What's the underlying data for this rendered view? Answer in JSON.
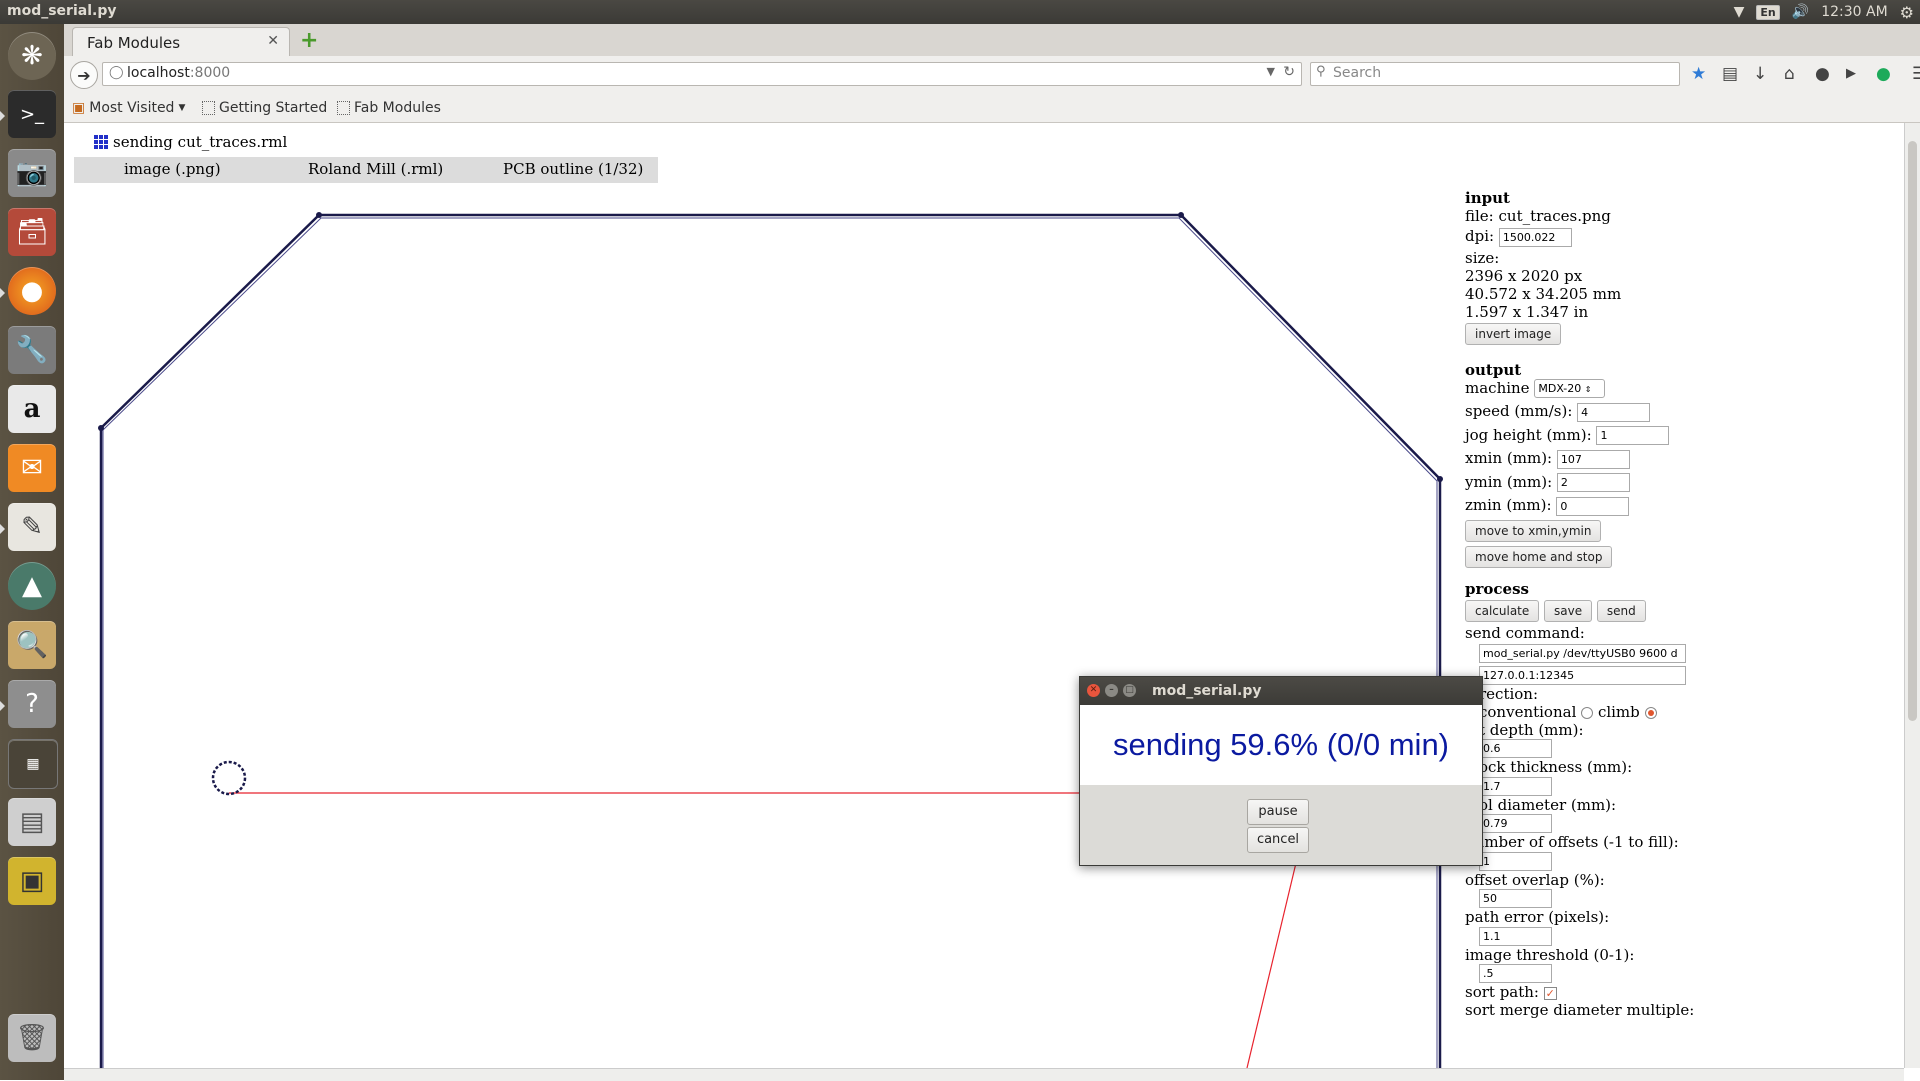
{
  "window": {
    "app_title": "mod_serial.py",
    "clock": "12:30 AM",
    "keyboard_layout": "En"
  },
  "launcher": {
    "items": [
      "dash-icon",
      "terminal-icon",
      "camera-icon",
      "files-icon",
      "firefox-icon",
      "settings-icon",
      "amazon-icon",
      "mail-icon",
      "text-editor-icon",
      "software-updater-icon",
      "image-viewer-icon",
      "help-icon",
      "workspaces-icon",
      "drive-icon",
      "remote-desktop-icon",
      "trash-icon"
    ]
  },
  "browser": {
    "tab_title": "Fab Modules",
    "url_host": "localhost",
    "url_port": ":8000",
    "search_placeholder": "Search",
    "bookmarks": [
      "Most Visited",
      "Getting Started",
      "Fab Modules"
    ]
  },
  "page": {
    "status": "sending cut_traces.rml",
    "menu": [
      "image (.png)",
      "Roland Mill (.rml)",
      "PCB outline (1/32)"
    ]
  },
  "panel": {
    "input": {
      "heading": "input",
      "file": "file: cut_traces.png",
      "dpi_label": "dpi:",
      "dpi": "1500.022",
      "size_label": "size:",
      "size_px": "2396 x 2020 px",
      "size_mm": "40.572 x 34.205 mm",
      "size_in": "1.597 x 1.347 in",
      "invert_button": "invert image"
    },
    "output": {
      "heading": "output",
      "machine_label": "machine",
      "machine": "MDX-20",
      "speed_label": "speed (mm/s):",
      "speed": "4",
      "jog_label": "jog height (mm):",
      "jog": "1",
      "xmin_label": "xmin (mm):",
      "xmin": "107",
      "ymin_label": "ymin (mm):",
      "ymin": "2",
      "zmin_label": "zmin (mm):",
      "zmin": "0",
      "move_button": "move to xmin,ymin",
      "home_button": "move home and stop"
    },
    "process": {
      "heading": "process",
      "calculate_button": "calculate",
      "save_button": "save",
      "send_button": "send",
      "send_command_label": "send command:",
      "send_command": "mod_serial.py /dev/ttyUSB0 9600 d",
      "server": "127.0.0.1:12345",
      "direction_label": "rection:",
      "conventional_label": "conventional",
      "climb_label": "climb",
      "direction": "climb",
      "cut_depth_label": "t depth (mm):",
      "cut_depth": "0.6",
      "stock_label": "ock thickness (mm):",
      "stock": "1.7",
      "tool_label": "ol diameter (mm):",
      "tool": "0.79",
      "offsets_label": "number of offsets (-1 to fill):",
      "offsets": "1",
      "overlap_label": "offset overlap (%):",
      "overlap": "50",
      "path_error_label": "path error (pixels):",
      "path_error": "1.1",
      "threshold_label": "image threshold (0-1):",
      "threshold": ".5",
      "sort_label": "sort path:",
      "sort_checked": true,
      "merge_label": "sort merge diameter multiple:"
    }
  },
  "dialog": {
    "title": "mod_serial.py",
    "message": "sending 59.6% (0/0 min)",
    "progress_percent": 59.6,
    "pause_button": "pause",
    "cancel_button": "cancel"
  },
  "colors": {
    "toolpath": "#1a1a4a",
    "jog_path": "#e8232e",
    "dialog_text": "#0b1aa0",
    "launcher_bg": "#574f40"
  }
}
